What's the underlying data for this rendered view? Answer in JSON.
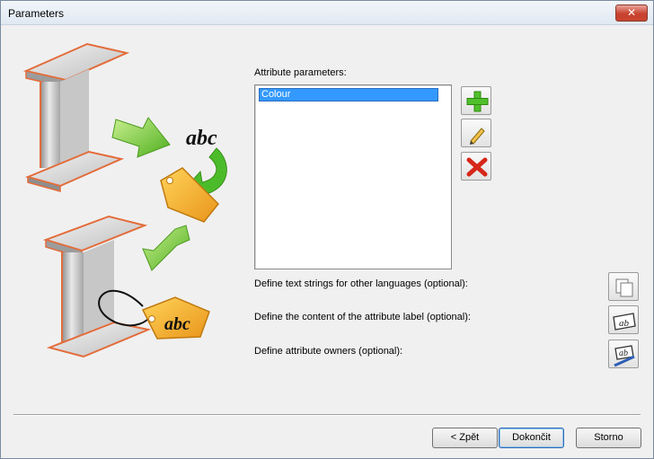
{
  "window": {
    "title": "Parameters",
    "close_glyph": "✕"
  },
  "illustration": {
    "text_top": "abc",
    "text_tag": "abc"
  },
  "attributes": {
    "label": "Attribute parameters:",
    "items": [
      {
        "label": "Colour",
        "selected": true
      }
    ]
  },
  "side_buttons": [
    {
      "icon": "add-icon"
    },
    {
      "icon": "edit-pencil-icon"
    },
    {
      "icon": "delete-icon"
    }
  ],
  "options": {
    "languages_label": "Define text strings for other languages (optional):",
    "label_content_label": "Define the content of the attribute label (optional):",
    "owners_label": "Define attribute owners (optional):"
  },
  "footer": {
    "back_label": "< Zpět",
    "finish_label": "Dokončit",
    "cancel_label": "Storno"
  },
  "colors": {
    "beam_edge": "#e36c3a",
    "tag": "#f5a81c",
    "arrow": "#6cc832",
    "selection": "#3399ff"
  }
}
